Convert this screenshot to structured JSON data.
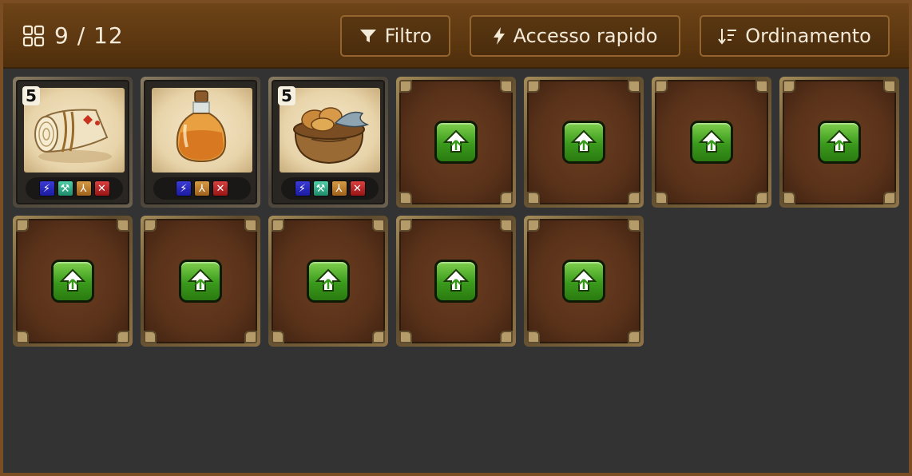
{
  "header": {
    "grid_icon": "grid-icon",
    "count": "9 / 12",
    "buttons": {
      "filter": {
        "label": "Filtro",
        "icon": "filter-icon"
      },
      "quick": {
        "label": "Accesso rapido",
        "icon": "lightning-icon"
      },
      "sort": {
        "label": "Ordinamento",
        "icon": "sort-icon"
      }
    }
  },
  "slots": [
    {
      "item": "bandage-roll",
      "quantity": "5",
      "actions": [
        "use",
        "equip",
        "split",
        "discard"
      ]
    },
    {
      "item": "potion-bottle",
      "quantity": "",
      "actions": [
        "use",
        "split",
        "discard"
      ]
    },
    {
      "item": "food-sack",
      "quantity": "5",
      "actions": [
        "use",
        "equip",
        "split",
        "discard"
      ]
    },
    {
      "state": "locked",
      "icon": "unlock-slot-icon"
    },
    {
      "state": "locked",
      "icon": "unlock-slot-icon"
    },
    {
      "state": "locked",
      "icon": "unlock-slot-icon"
    },
    {
      "state": "locked",
      "icon": "unlock-slot-icon"
    },
    {
      "state": "locked",
      "icon": "unlock-slot-icon"
    },
    {
      "state": "locked",
      "icon": "unlock-slot-icon"
    },
    {
      "state": "locked",
      "icon": "unlock-slot-icon"
    },
    {
      "state": "locked",
      "icon": "unlock-slot-icon"
    },
    {
      "state": "locked",
      "icon": "unlock-slot-icon"
    }
  ],
  "colors": {
    "header_brown": "#5c3710",
    "frame_brown": "#7a4e22",
    "background": "#333333",
    "unlock_green": "#3a9a1c"
  }
}
